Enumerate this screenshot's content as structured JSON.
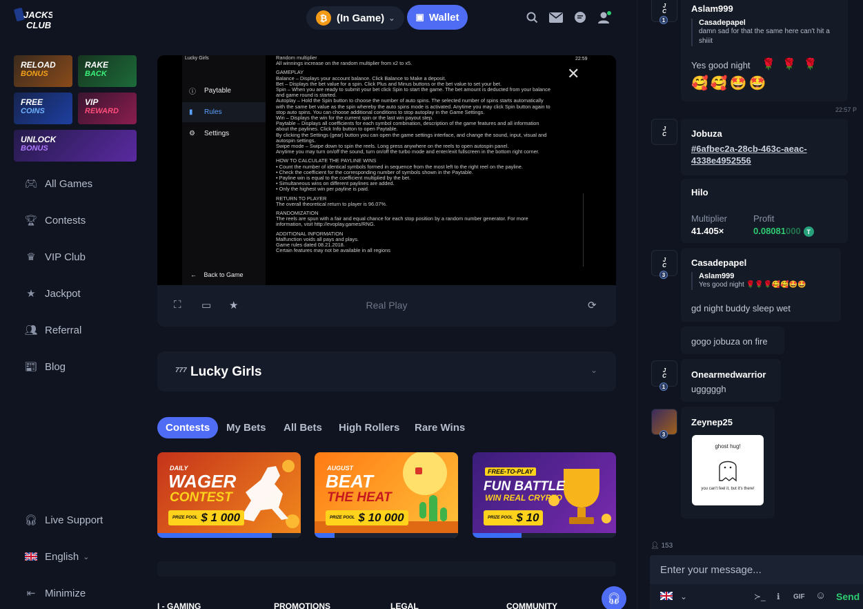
{
  "brand": {
    "logo_line1": "JACKS",
    "logo_line2": "CLUB"
  },
  "promos": [
    {
      "line1": "RELOAD",
      "line2": "BONUS",
      "accent": "#f7a21b"
    },
    {
      "line1": "RAKE",
      "line2": "BACK",
      "accent": "#3cf07a"
    },
    {
      "line1": "FREE",
      "line2": "COINS",
      "accent": "#6fb3ff"
    },
    {
      "line1": "VIP",
      "line2": "REWARD",
      "accent": "#ff4d7a"
    },
    {
      "line1": "UNLOCK",
      "line2": "BONUS",
      "accent": "#b07cff"
    }
  ],
  "nav": [
    {
      "label": "All Games",
      "icon": "gamepad-icon"
    },
    {
      "label": "Contests",
      "icon": "trophy-icon"
    },
    {
      "label": "VIP Club",
      "icon": "crown-icon"
    },
    {
      "label": "Jackpot",
      "icon": "star-icon"
    },
    {
      "label": "Referral",
      "icon": "users-icon"
    },
    {
      "label": "Blog",
      "icon": "newspaper-icon"
    }
  ],
  "bottom_nav": {
    "support": "Live Support",
    "language": "English",
    "minimize": "Minimize"
  },
  "header": {
    "balance_label": "(In Game)",
    "currency_symbol": "₿",
    "wallet_label": "Wallet"
  },
  "game": {
    "menu_title": "Lucky Girls",
    "time": "22:59",
    "menu": [
      "Paytable",
      "Rules",
      "Settings"
    ],
    "back_label": "Back to Game",
    "rules_lines": [
      "Random multiplier",
      "All winnings increase on the random multiplier from x2 to x5.",
      "",
      "GAMEPLAY",
      "Balance – Displays your account balance. Click Balance to Make a deposit.",
      "Bet – Displays the bet value for a spin. Click Plus and Minus buttons or the bet value to set your bet.",
      "Spin – When you are ready to submit your bet click Spin to start the game. The bet amount is deducted from your balance",
      "and game round is started.",
      "Autoplay – Hold the Spin button to choose the number of auto spins. The selected number of spins starts automatically",
      "with the same bet value as the spin whereby the auto spins mode is activated. Anytime you may click Spin button again to",
      "stop auto spins. You can choose additional conditions to stop autoplay in the Game Settings.",
      "Win – Displays the win for the current spin or the last win payout step.",
      "Paytable – Displays all coefficients for each symbol combination, description of the game features and all information",
      "about the paylines. Click Info button to open Paytable.",
      "By clicking the Settings (gear) button you can open the game settings interface, and change the sound, input, visual and",
      "autospin settings.",
      "Swipe mode – Swipe down to spin the reels. Long press anywhere on the reels to open autospin panel.",
      "Anytime you may turn on/off the sound, turn on/off the turbo mode and enter/exit fullscreen in the bottom right corner.",
      "",
      "HOW TO CALCULATE THE PAYLINE WINS",
      "• Count the number of identical symbols formed in sequence from the most left to the right reel on the payline.",
      "• Check the coefficient for the corresponding number of symbols shown in the Paytable.",
      "• Payline win is equal to the coefficient multiplied by the bet.",
      "• Simultaneous wins on different paylines are added.",
      "• Only the highest win per payline is paid.",
      "",
      "RETURN TO PLAYER",
      "The overall theoretical return to player is 96.07%.",
      "",
      "RANDOMIZATION",
      "The reels are spun with a fair and equal chance for each stop position by a random number generator. For more",
      "information, visit http://evoplay.games/RNG.",
      "",
      "ADDITIONAL INFORMATION",
      "Malfunction voids all pays and plays.",
      "Game rules dated 08.21.2018.",
      "Certain features may not be available in all regions"
    ],
    "mode_label": "Real Play",
    "title": "Lucky Girls",
    "title_badge": "777"
  },
  "tabs": [
    "Contests",
    "My Bets",
    "All Bets",
    "High Rollers",
    "Rare Wins"
  ],
  "cards": [
    {
      "kicker": "DAILY",
      "big1": "WAGER",
      "big2": "CONTEST",
      "prize_label": "PRIZE POOL",
      "prize": "$ 1 000",
      "progress": 0.8,
      "colors": [
        "#c5331b",
        "#f28a1c"
      ],
      "big2_color": "#ffd21c"
    },
    {
      "kicker": "AUGUST",
      "big1": "BEAT",
      "big2": "THE HEAT",
      "prize_label": "PRIZE POOL",
      "prize": "$ 10 000",
      "progress": 0.14,
      "colors": [
        "#ff7a14",
        "#ffc33a"
      ],
      "big2_color": "#c6191f"
    },
    {
      "kicker": "FREE-TO-PLAY",
      "big1": "FUN BATTLE",
      "big2": "WIN REAL CRYPTO",
      "prize_label": "PRIZE POOL",
      "prize": "$ 10",
      "progress": 0.34,
      "colors": [
        "#3a1d7a",
        "#7a2bb0"
      ],
      "big2_color": "#ffd21c"
    }
  ],
  "footer": [
    "I - GAMING",
    "PROMOTIONS",
    "LEGAL",
    "COMMUNITY"
  ],
  "chat": {
    "msg1": {
      "user": "Aslam999",
      "level": "1",
      "quote_user": "Casadepapel",
      "quote_text": "damn sad for that the same here can't hit a shiiit",
      "text": "Yes good night",
      "emojis1": "🌹 🌹 🌹",
      "emojis2": "🥰🥰🤩🤩"
    },
    "timestamp": "22:57 P",
    "msg2": {
      "user": "Jobuza",
      "hash": "#6afbec2a-28cb-463c-aeac-4338e4952556",
      "game": "Hilo",
      "mult_label": "Multiplier",
      "mult": "41.405×",
      "profit_label": "Profit",
      "profit_main": "0.08081",
      "profit_tail": "000",
      "coin": "T"
    },
    "msg3": {
      "user": "Casadepapel",
      "level": "3",
      "quote_user": "Aslam999",
      "quote_text": "Yes good night 🌹🌹🌹🥰🥰🤩🤩",
      "text": "gd night buddy sleep wet",
      "text2": "gogo jobuza on fire"
    },
    "msg4": {
      "user": "Onearmedwarrior",
      "level": "1",
      "text": "ugggggh"
    },
    "msg5": {
      "user": "Zeynep25",
      "level": "3",
      "sticker_top": "ghost hug!",
      "sticker_bottom": "you can't feel it, but it's there!"
    },
    "online_count": "153",
    "input_placeholder": "Enter your message...",
    "gif_label": "GIF",
    "send_label": "Send"
  }
}
